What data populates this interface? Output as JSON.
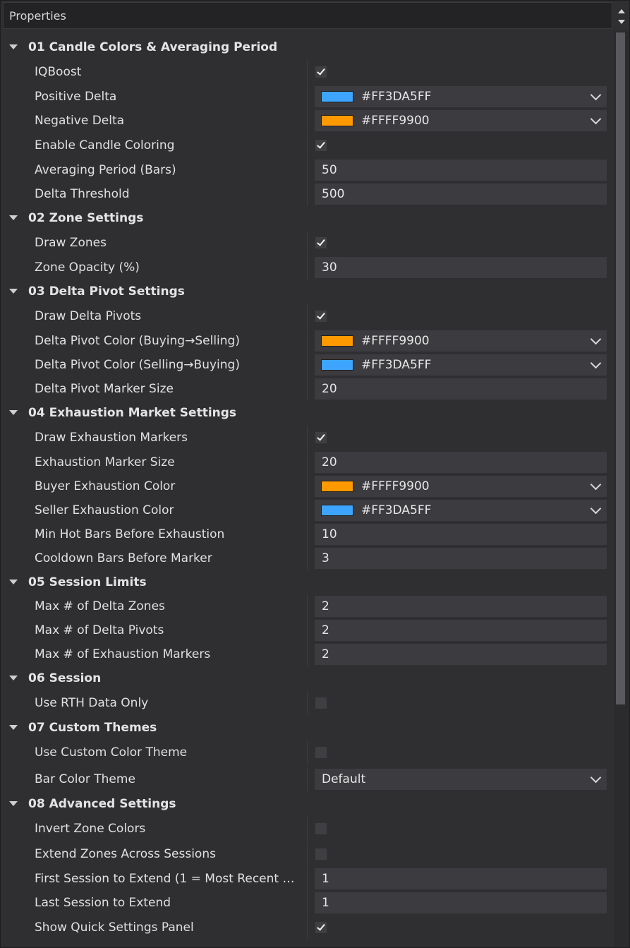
{
  "window": {
    "title": "Properties"
  },
  "sections": [
    {
      "label": "01 Candle Colors & Averaging Period",
      "rows": [
        {
          "label": "IQBoost",
          "type": "checkbox",
          "checked": true
        },
        {
          "label": "Positive Delta",
          "type": "color",
          "value": "#FF3DA5FF",
          "swatch": "#3DA5FF"
        },
        {
          "label": "Negative Delta",
          "type": "color",
          "value": "#FFFF9900",
          "swatch": "#FF9900"
        },
        {
          "label": "Enable Candle Coloring",
          "type": "checkbox",
          "checked": true
        },
        {
          "label": "Averaging Period (Bars)",
          "type": "text",
          "value": "50"
        },
        {
          "label": "Delta Threshold",
          "type": "text",
          "value": "500"
        }
      ]
    },
    {
      "label": "02 Zone Settings",
      "rows": [
        {
          "label": "Draw Zones",
          "type": "checkbox",
          "checked": true
        },
        {
          "label": "Zone Opacity (%)",
          "type": "text",
          "value": "30"
        }
      ]
    },
    {
      "label": "03 Delta Pivot Settings",
      "rows": [
        {
          "label": "Draw Delta Pivots",
          "type": "checkbox",
          "checked": true
        },
        {
          "label": "Delta Pivot Color (Buying→Selling)",
          "type": "color",
          "value": "#FFFF9900",
          "swatch": "#FF9900"
        },
        {
          "label": "Delta Pivot Color (Selling→Buying)",
          "type": "color",
          "value": "#FF3DA5FF",
          "swatch": "#3DA5FF"
        },
        {
          "label": "Delta Pivot Marker Size",
          "type": "text",
          "value": "20"
        }
      ]
    },
    {
      "label": "04 Exhaustion Market Settings",
      "rows": [
        {
          "label": "Draw Exhaustion Markers",
          "type": "checkbox",
          "checked": true
        },
        {
          "label": "Exhaustion Marker Size",
          "type": "text",
          "value": "20"
        },
        {
          "label": "Buyer Exhaustion Color",
          "type": "color",
          "value": "#FFFF9900",
          "swatch": "#FF9900"
        },
        {
          "label": "Seller Exhaustion Color",
          "type": "color",
          "value": "#FF3DA5FF",
          "swatch": "#3DA5FF"
        },
        {
          "label": "Min Hot Bars Before Exhaustion",
          "type": "text",
          "value": "10"
        },
        {
          "label": "Cooldown Bars Before Marker",
          "type": "text",
          "value": "3"
        }
      ]
    },
    {
      "label": "05 Session Limits",
      "rows": [
        {
          "label": "Max # of Delta Zones",
          "type": "text",
          "value": "2"
        },
        {
          "label": "Max # of Delta Pivots",
          "type": "text",
          "value": "2"
        },
        {
          "label": "Max # of Exhaustion Markers",
          "type": "text",
          "value": "2"
        }
      ]
    },
    {
      "label": "06 Session",
      "rows": [
        {
          "label": "Use RTH Data Only",
          "type": "checkbox",
          "checked": false
        }
      ]
    },
    {
      "label": "07 Custom Themes",
      "rows": [
        {
          "label": "Use Custom Color Theme",
          "type": "checkbox",
          "checked": false
        },
        {
          "label": "Bar Color Theme",
          "type": "select",
          "value": "Default"
        }
      ]
    },
    {
      "label": "08 Advanced Settings",
      "rows": [
        {
          "label": "Invert Zone Colors",
          "type": "checkbox",
          "checked": false
        },
        {
          "label": "Extend Zones Across Sessions",
          "type": "checkbox",
          "checked": false
        },
        {
          "label": "First Session to Extend (1 = Most Recent Com...",
          "type": "text",
          "value": "1"
        },
        {
          "label": "Last Session to Extend",
          "type": "text",
          "value": "1"
        },
        {
          "label": "Show Quick Settings Panel",
          "type": "checkbox",
          "checked": true
        }
      ]
    }
  ]
}
